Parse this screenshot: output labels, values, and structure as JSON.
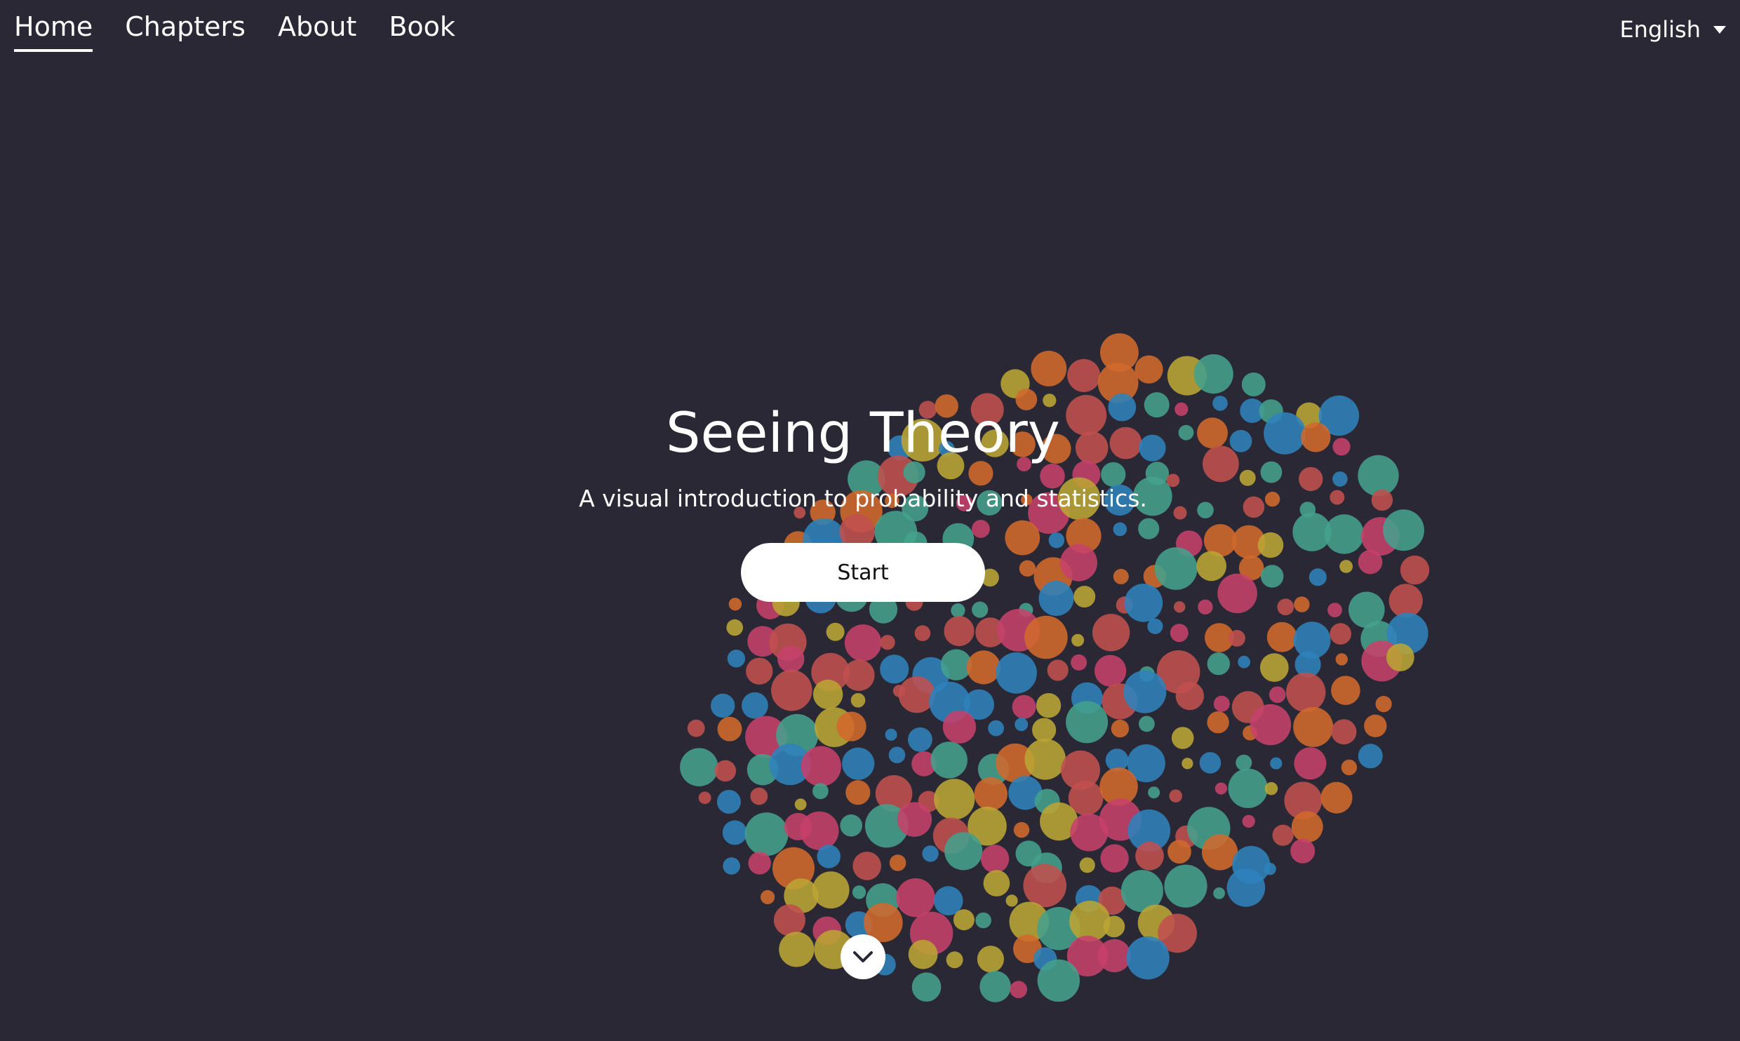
{
  "nav": {
    "items": [
      {
        "label": "Home",
        "active": true
      },
      {
        "label": "Chapters",
        "active": false
      },
      {
        "label": "About",
        "active": false
      },
      {
        "label": "Book",
        "active": false
      }
    ]
  },
  "language": {
    "selected": "English",
    "icon": "caret-down-icon"
  },
  "hero": {
    "title": "Seeing Theory",
    "subtitle": "A visual introduction to probability and statistics.",
    "start_label": "Start"
  },
  "scroll": {
    "icon": "chevron-down-icon"
  },
  "colors": {
    "background": "#2a2835",
    "bubble_palette": [
      "#c0504f",
      "#c6416b",
      "#d2692c",
      "#44a08c",
      "#2f82bc",
      "#bba534"
    ]
  }
}
